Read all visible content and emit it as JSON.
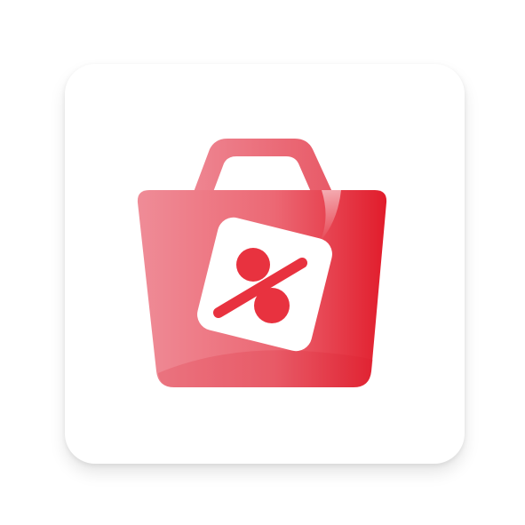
{
  "app_icon": {
    "icon_name": "shopping-bag-discount-icon",
    "colors": {
      "tile_background": "#ffffff",
      "bag_light": "#ee8a95",
      "bag_dark": "#e11f2d",
      "handle": "#ea6f7c",
      "tag_background": "#ffffff",
      "tag_symbol": "#e8323f"
    }
  }
}
